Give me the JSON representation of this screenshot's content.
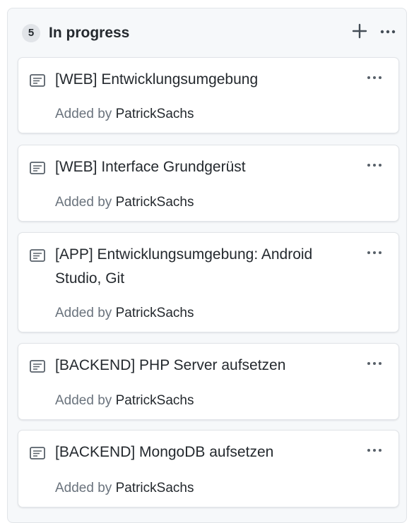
{
  "column": {
    "count": "5",
    "title": "In progress",
    "add_icon": "plus-icon",
    "more_icon": "kebab-horizontal-icon"
  },
  "cards": [
    {
      "icon": "note-icon",
      "title": "[WEB] Entwicklungsumgebung",
      "added_by_label": "Added by",
      "author": "PatrickSachs"
    },
    {
      "icon": "note-icon",
      "title": "[WEB] Interface Grundgerüst",
      "added_by_label": "Added by",
      "author": "PatrickSachs"
    },
    {
      "icon": "note-icon",
      "title": "[APP] Entwicklungsumgebung: Android Studio, Git",
      "added_by_label": "Added by",
      "author": "PatrickSachs"
    },
    {
      "icon": "note-icon",
      "title": "[BACKEND] PHP Server aufsetzen",
      "added_by_label": "Added by",
      "author": "PatrickSachs"
    },
    {
      "icon": "note-icon",
      "title": "[BACKEND] MongoDB aufsetzen",
      "added_by_label": "Added by",
      "author": "PatrickSachs"
    }
  ],
  "colors": {
    "column_bg": "#f6f8fa",
    "card_bg": "#ffffff",
    "text_primary": "#24292e",
    "text_muted": "#6a737d",
    "border": "#e1e4e8"
  }
}
